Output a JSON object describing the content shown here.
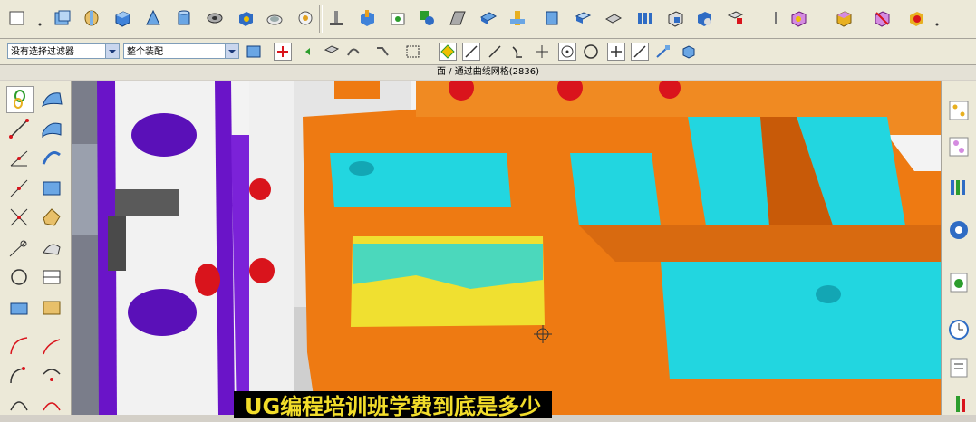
{
  "window_title": "面 / 通过曲线网格(2836)",
  "filter_dropdown": {
    "value": "没有选择过滤器"
  },
  "assembly_dropdown": {
    "value": "整个装配"
  },
  "caption": "UG编程培训班学费到底是多少",
  "toolbar_icons": [
    "sketch",
    "extrude",
    "revolve",
    "block",
    "cone",
    "cylinder",
    "tube",
    "sphere",
    "shell",
    "edge-blend",
    "chamfer",
    "hole",
    "boss",
    "pocket",
    "pad",
    "slot",
    "groove",
    "thread",
    "trim-body",
    "split-body",
    "unite",
    "subtract",
    "intersect",
    "offset-face",
    "sew",
    "patch",
    "move-face",
    "mirror"
  ],
  "snap_icons": [
    "vertex-snap",
    "line-snap",
    "arc-snap",
    "tangent-snap",
    "center-snap",
    "circle-snap",
    "cross-snap",
    "slash-snap",
    "view-snap",
    "part-snap"
  ],
  "colors": {
    "cad_orange": "#ee7a12",
    "cad_cyan": "#22d6e0",
    "cad_purple": "#6a14c8",
    "cad_red": "#d9141c",
    "caption_text": "#f2dd2a"
  }
}
